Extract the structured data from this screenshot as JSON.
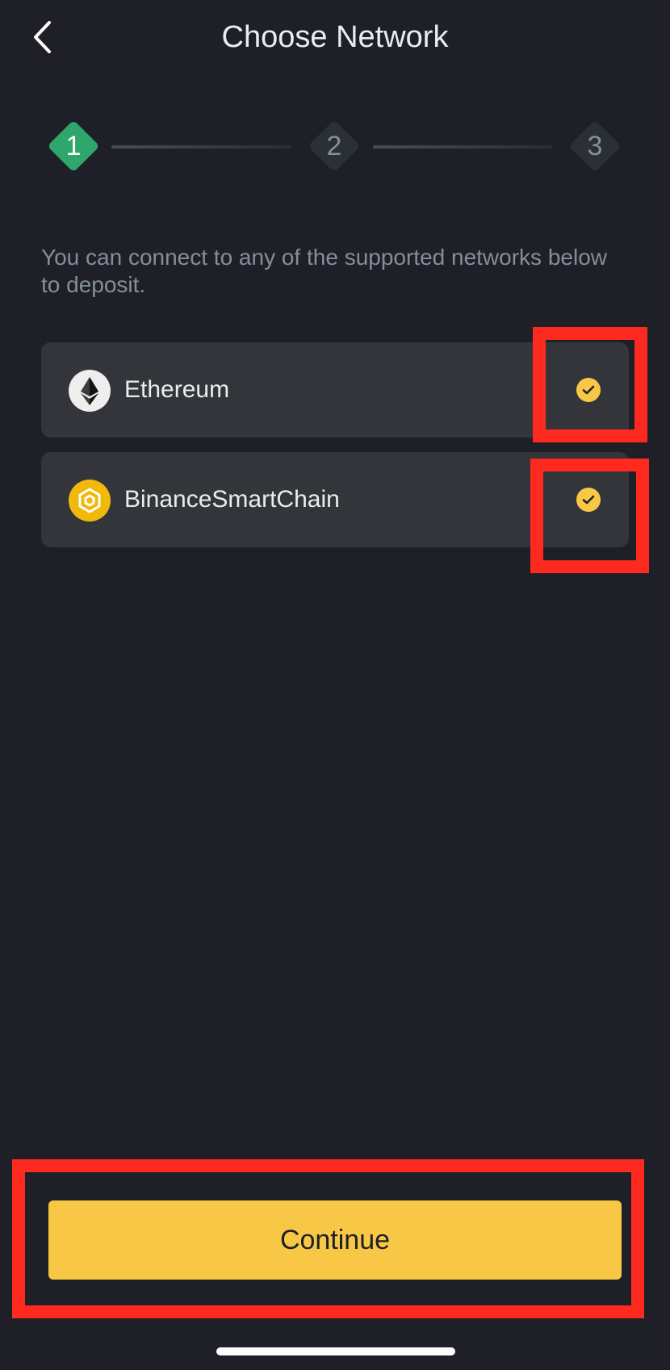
{
  "header": {
    "title": "Choose Network",
    "back_icon": "chevron-left-icon"
  },
  "stepper": {
    "steps": [
      {
        "label": "1",
        "state": "active"
      },
      {
        "label": "2",
        "state": "inactive"
      },
      {
        "label": "3",
        "state": "inactive"
      }
    ]
  },
  "description": "You can connect to any of the supported networks below to deposit.",
  "networks": [
    {
      "name": "Ethereum",
      "icon": "ethereum-icon",
      "selected": true
    },
    {
      "name": "BinanceSmartChain",
      "icon": "bnb-icon",
      "selected": true
    }
  ],
  "footer": {
    "continue_label": "Continue"
  },
  "colors": {
    "background": "#1f2027",
    "accent": "#f8c746",
    "active_step": "#2ea66c",
    "highlight": "#ff2a1f",
    "card": "#33353b"
  }
}
